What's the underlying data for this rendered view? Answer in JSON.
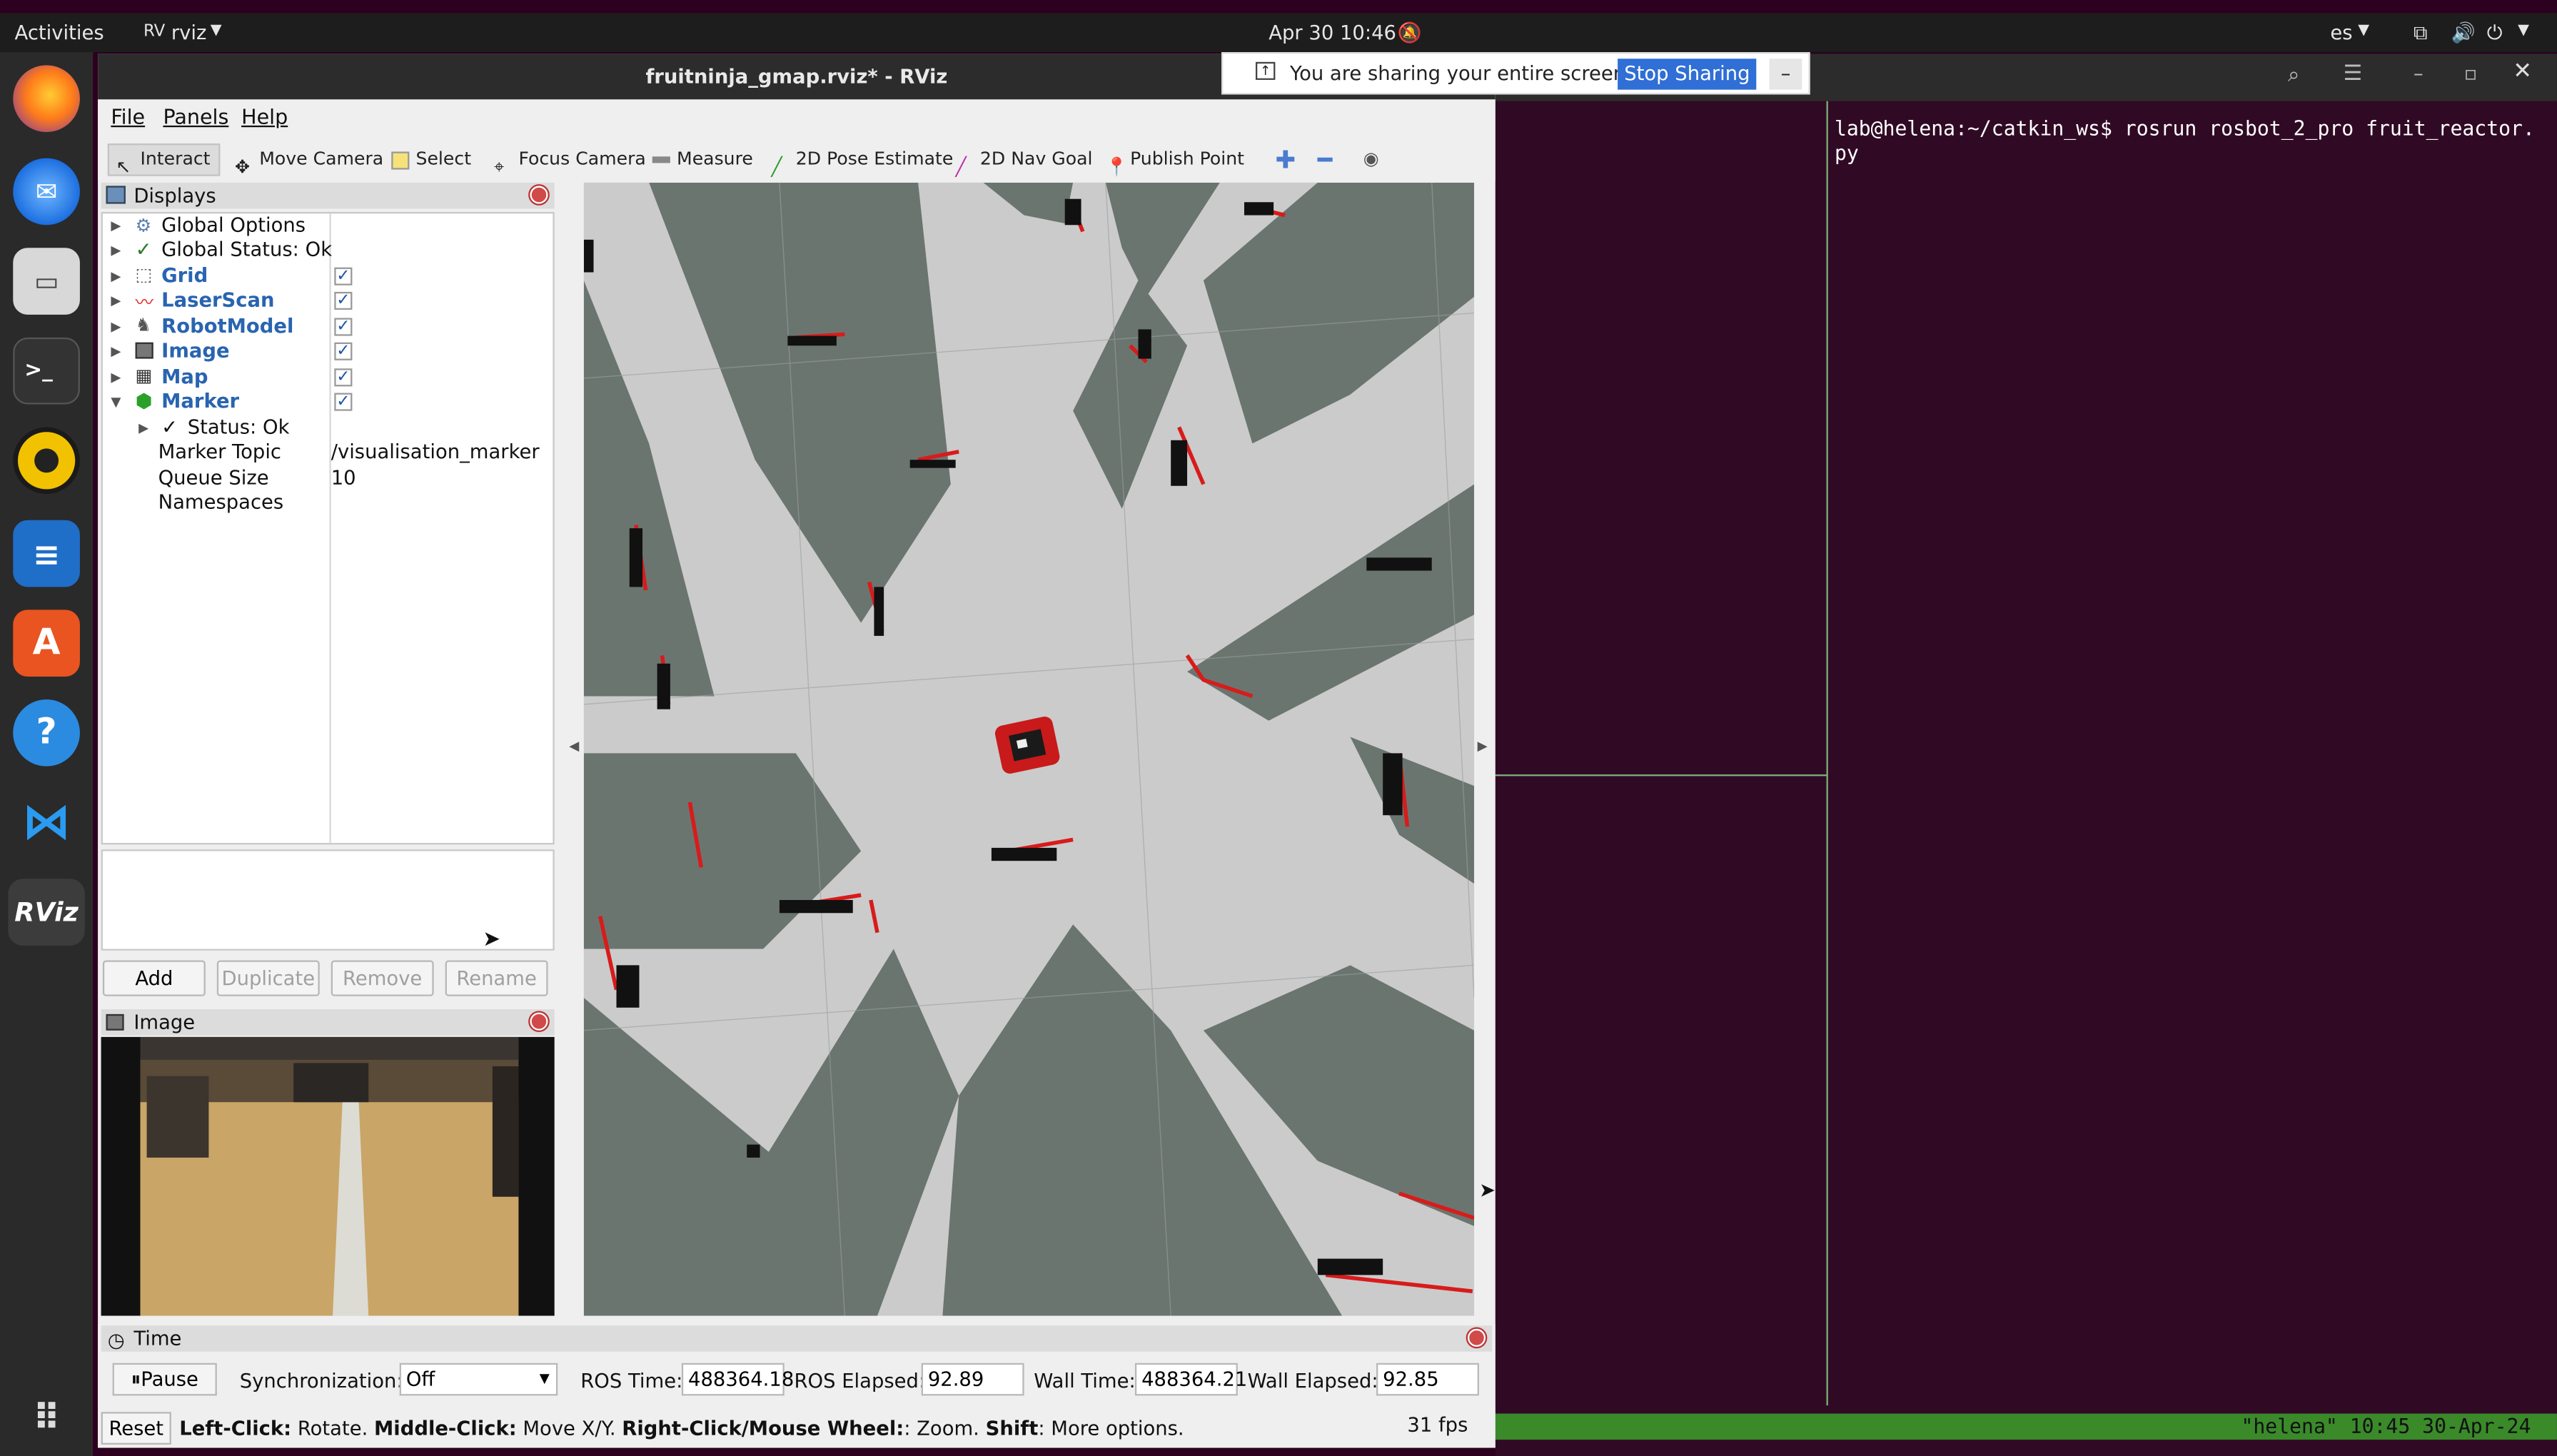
{
  "topbar": {
    "activities": "Activities",
    "app_name": "rviz",
    "datetime": "Apr 30  10:46",
    "lang": "es"
  },
  "window": {
    "title": "fruitninja_gmap.rviz* - RViz"
  },
  "share": {
    "text": "You are sharing your entire screen.",
    "button": "Stop Sharing",
    "min": "–"
  },
  "menu": {
    "file": "File",
    "panels": "Panels",
    "help": "Help"
  },
  "toolbar": {
    "interact": "Interact",
    "move_camera": "Move Camera",
    "select": "Select",
    "focus_camera": "Focus Camera",
    "measure": "Measure",
    "pose_estimate": "2D Pose Estimate",
    "nav_goal": "2D Nav Goal",
    "publish_point": "Publish Point"
  },
  "displays": {
    "title": "Displays",
    "items": [
      {
        "label": "Global Options"
      },
      {
        "label": "Global Status: Ok"
      },
      {
        "label": "Grid",
        "checked": "✓"
      },
      {
        "label": "LaserScan",
        "checked": "✓"
      },
      {
        "label": "RobotModel",
        "checked": "✓"
      },
      {
        "label": "Image",
        "checked": "✓"
      },
      {
        "label": "Map",
        "checked": "✓"
      },
      {
        "label": "Marker",
        "checked": "✓"
      }
    ],
    "marker_children": [
      {
        "label": "Status: Ok",
        "value": ""
      },
      {
        "label": "Marker Topic",
        "value": "/visualisation_marker"
      },
      {
        "label": "Queue Size",
        "value": "10"
      },
      {
        "label": "Namespaces",
        "value": ""
      }
    ],
    "buttons": {
      "add": "Add",
      "duplicate": "Duplicate",
      "remove": "Remove",
      "rename": "Rename"
    }
  },
  "image_panel": {
    "title": "Image"
  },
  "time_panel": {
    "title": "Time",
    "pause": "Pause",
    "sync_label": "Synchronization:",
    "sync_value": "Off",
    "ros_time_label": "ROS Time:",
    "ros_time": "488364.18",
    "ros_elapsed_label": "ROS Elapsed:",
    "ros_elapsed": "92.89",
    "wall_time_label": "Wall Time:",
    "wall_time": "488364.21",
    "wall_elapsed_label": "Wall Elapsed:",
    "wall_elapsed": "92.85"
  },
  "status": {
    "reset": "Reset",
    "left": "Left-Click:",
    "left_t": " Rotate. ",
    "middle": "Middle-Click:",
    "middle_t": " Move X/Y. ",
    "right": "Right-Click/Mouse Wheel:",
    "right_t": ": Zoom. ",
    "shift": "Shift",
    "shift_t": ": More options.",
    "fps": "31 fps"
  },
  "terminal": {
    "line1": "lab@helena:~/catkin_ws$ rosrun rosbot_2_pro fruit_reactor.",
    "line2": "py",
    "status_bar": "\"helena\" 10:45 30-Apr-24"
  },
  "colors": {
    "map_free": "#c9c9c9",
    "map_occupied": "#6b7570",
    "laser": "#d81b1b",
    "terminal_bg": "#300a24",
    "accent": "#2964b0"
  }
}
